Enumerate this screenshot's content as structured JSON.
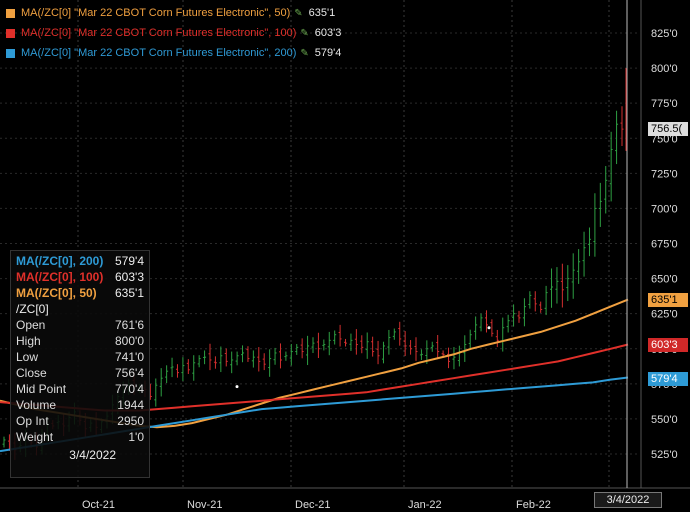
{
  "legend": [
    {
      "label": "MA(/ZC[0] \"Mar 22 CBOT Corn Futures Electronic\", 50)",
      "value": "635'1",
      "color": "#f0a040",
      "icon": "pencil-edit-icon"
    },
    {
      "label": "MA(/ZC[0] \"Mar 22 CBOT Corn Futures Electronic\", 100)",
      "value": "603'3",
      "color": "#e0302a",
      "icon": "pencil-edit-icon"
    },
    {
      "label": "MA(/ZC[0] \"Mar 22 CBOT Corn Futures Electronic\", 200)",
      "value": "579'4",
      "color": "#2e9bd6",
      "icon": "pencil-edit-icon"
    }
  ],
  "price_tags": {
    "last": {
      "text": "756.5(",
      "bg": "#dddddd",
      "fg": "#000000"
    },
    "ma50": {
      "text": "635'1",
      "bg": "#f0a040",
      "fg": "#000000"
    },
    "ma100": {
      "text": "603'3",
      "bg": "#d02828",
      "fg": "#ffffff"
    },
    "ma200": {
      "text": "579'4",
      "bg": "#2e9bd6",
      "fg": "#ffffff"
    }
  },
  "databox": {
    "ma200": {
      "label": "MA(/ZC[0], 200)",
      "value": "579'4",
      "color": "#2e9bd6"
    },
    "ma100": {
      "label": "MA(/ZC[0], 100)",
      "value": "603'3",
      "color": "#e0302a"
    },
    "ma50": {
      "label": "MA(/ZC[0], 50)",
      "value": "635'1",
      "color": "#f0a040"
    },
    "symbol": "/ZC[0]",
    "rows": [
      {
        "label": "Open",
        "value": "761'6"
      },
      {
        "label": "High",
        "value": "800'0"
      },
      {
        "label": "Low",
        "value": "741'0"
      },
      {
        "label": "Close",
        "value": "756'4"
      },
      {
        "label": "Mid Point",
        "value": "770'4"
      },
      {
        "label": "Volume",
        "value": "1944"
      },
      {
        "label": "Op Int",
        "value": "2950"
      },
      {
        "label": "Weight",
        "value": "1'0"
      }
    ],
    "date": "3/4/2022"
  },
  "cursor_date": "3/4/2022",
  "chart_data": {
    "type": "line",
    "ylim": [
      500,
      840
    ],
    "y_ticks": [
      {
        "value": 525,
        "label": "525'0"
      },
      {
        "value": 550,
        "label": "550'0"
      },
      {
        "value": 575,
        "label": "575'0"
      },
      {
        "value": 600,
        "label": "600'0"
      },
      {
        "value": 625,
        "label": "625'0"
      },
      {
        "value": 650,
        "label": "650'0"
      },
      {
        "value": 675,
        "label": "675'0"
      },
      {
        "value": 700,
        "label": "700'0"
      },
      {
        "value": 725,
        "label": "725'0"
      },
      {
        "value": 750,
        "label": "750'0"
      },
      {
        "value": 775,
        "label": "775'0"
      },
      {
        "value": 800,
        "label": "800'0"
      },
      {
        "value": 825,
        "label": "825'0"
      }
    ],
    "x_labels": [
      "Oct-21",
      "Nov-21",
      "Dec-21",
      "Jan-22",
      "Feb-22"
    ],
    "series": [
      {
        "name": "MA(/ZC[0] \"Mar 22 CBOT Corn Futures Electronic\", 50)",
        "color": "#f0a040",
        "values": [
          563,
          560,
          557,
          555,
          553,
          551,
          549,
          547,
          545,
          544,
          545,
          547,
          550,
          553,
          557,
          561,
          565,
          568,
          571,
          574,
          577,
          580,
          583,
          586,
          590,
          593,
          596,
          600,
          603,
          606,
          609,
          612,
          616,
          620,
          625,
          630,
          635
        ]
      },
      {
        "name": "MA(/ZC[0] \"Mar 22 CBOT Corn Futures Electronic\", 100)",
        "color": "#e0302a",
        "values": [
          562,
          561,
          560,
          559,
          558,
          557,
          556,
          556,
          556,
          557,
          558,
          559,
          560,
          561,
          562,
          563,
          564,
          565,
          566,
          567,
          568,
          569,
          571,
          573,
          575,
          577,
          579,
          581,
          583,
          585,
          587,
          589,
          591,
          594,
          597,
          600,
          603
        ]
      },
      {
        "name": "MA(/ZC[0] \"Mar 22 CBOT Corn Futures Electronic\", 200)",
        "color": "#2e9bd6",
        "values": [
          527,
          529,
          531,
          533,
          535,
          537,
          539,
          541,
          543,
          545,
          547,
          549,
          551,
          553,
          555,
          557,
          558,
          559,
          560,
          561,
          562,
          563,
          564,
          565,
          566,
          567,
          568,
          569,
          570,
          571,
          572,
          573,
          574,
          575,
          576,
          578,
          579.5
        ]
      }
    ],
    "closes": [
      535,
      532,
      528,
      531,
      536,
      533,
      530,
      540,
      546,
      545,
      548,
      545,
      551,
      555,
      549,
      543,
      547,
      544,
      548,
      552,
      560,
      566,
      570,
      575,
      573,
      572,
      571,
      566,
      574,
      579,
      584,
      587,
      583,
      588,
      585,
      590,
      593,
      594,
      592,
      590,
      595,
      591,
      592,
      595,
      597,
      593,
      594,
      591,
      589,
      593,
      597,
      592,
      595,
      598,
      601,
      598,
      602,
      604,
      600,
      603,
      606,
      610,
      607,
      604,
      606,
      603,
      601,
      605,
      598,
      595,
      602,
      608,
      612,
      607,
      602,
      600,
      598,
      596,
      600,
      602,
      598,
      596,
      591,
      594,
      598,
      603,
      610,
      617,
      622,
      617,
      611,
      606,
      615,
      620,
      625,
      622,
      630,
      638,
      632,
      628,
      640,
      644,
      648,
      642,
      650,
      656,
      662,
      672,
      678,
      700,
      705,
      720,
      742,
      760,
      756.5
    ]
  }
}
